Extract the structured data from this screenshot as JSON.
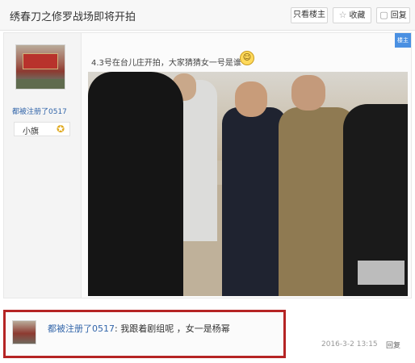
{
  "thread": {
    "title": "绣春刀之修罗战场即将开拍"
  },
  "toolbar": {
    "only_op_label": "只看楼主",
    "favorite_label": "收藏",
    "reply_label": "回复"
  },
  "post": {
    "username": "都被注册了0517",
    "rank_label": "小旗",
    "corner_badge": "楼主",
    "message": "4.3号在台儿庄开拍，大家猜猜女一号是谁"
  },
  "reply": {
    "username": "都被注册了0517",
    "text": ": 我跟着剧组呢 ，女一是杨幂",
    "timestamp": "2016-3-2 13:15",
    "reply_label": "回复"
  },
  "icons": {
    "favorite": "star-icon",
    "reply": "reply-icon",
    "rank": "star-badge-icon",
    "emoji": "smile-emoji-icon"
  }
}
